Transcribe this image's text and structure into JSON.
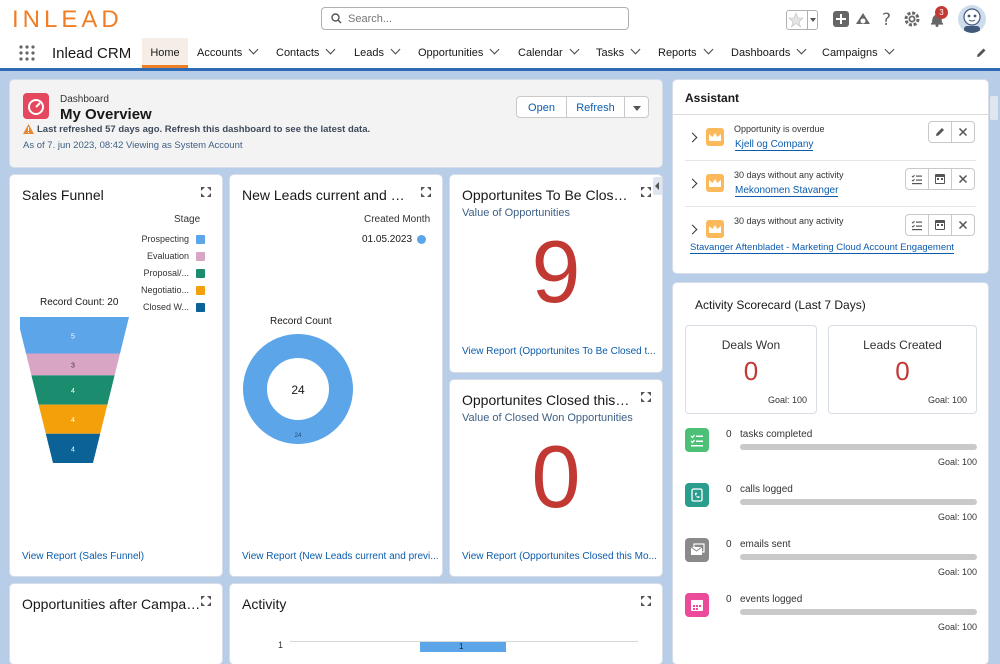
{
  "header": {
    "logo": "INLEAD",
    "search_placeholder": "Search...",
    "notification_count": "3"
  },
  "nav": {
    "app_name": "Inlead CRM",
    "items": [
      "Home",
      "Accounts",
      "Contacts",
      "Leads",
      "Opportunities",
      "Calendar",
      "Tasks",
      "Reports",
      "Dashboards",
      "Campaigns"
    ]
  },
  "dashboard": {
    "label": "Dashboard",
    "title": "My Overview",
    "warning": "Last refreshed 57 days ago. Refresh this dashboard to see the latest data.",
    "as_of": "As of 7. jun 2023, 08:42 Viewing as System Account",
    "open_label": "Open",
    "refresh_label": "Refresh"
  },
  "sales_funnel": {
    "title": "Sales Funnel",
    "legend_title": "Stage",
    "record_count_label": "Record Count: 20",
    "view_report": "View Report (Sales Funnel)"
  },
  "new_leads": {
    "title": "New Leads current and previ...",
    "legend_title": "Created Month",
    "record_count_label": "Record Count",
    "view_report": "View Report (New Leads current and previ..."
  },
  "opps_to_close": {
    "title": "Opportunites To Be Closed t...",
    "subtitle": "Value of Opportunities",
    "value": "9",
    "view_report": "View Report (Opportunites To Be Closed t..."
  },
  "opps_closed": {
    "title": "Opportunites Closed this Mo...",
    "subtitle": "Value of Closed Won Opportunities",
    "value": "0",
    "view_report": "View Report (Opportunites Closed this Mo..."
  },
  "opps_campaigns": {
    "title": "Opportunities after Campaigns"
  },
  "activity": {
    "title": "Activity",
    "axis_tick": "1",
    "bar_label": "1"
  },
  "assistant": {
    "title": "Assistant",
    "items": [
      {
        "text": "Opportunity is overdue",
        "link": "Kjell og Company"
      },
      {
        "text": "30 days without any activity",
        "link": "Mekonomen Stavanger"
      },
      {
        "text": "30 days without any activity",
        "link": "Stavanger Aftenbladet - Marketing Cloud Account Engagement"
      }
    ]
  },
  "scorecard": {
    "title": "Activity Scorecard (Last 7 Days)",
    "kpis": [
      {
        "label": "Deals Won",
        "value": "0",
        "goal": "Goal: 100"
      },
      {
        "label": "Leads Created",
        "value": "0",
        "goal": "Goal: 100"
      }
    ],
    "activities": [
      {
        "count": "0",
        "label": "tasks completed",
        "goal": "Goal: 100",
        "color": "#4bc076"
      },
      {
        "count": "0",
        "label": "calls logged",
        "goal": "Goal: 100",
        "color": "#2a9d8f"
      },
      {
        "count": "0",
        "label": "emails sent",
        "goal": "Goal: 100",
        "color": "#8a8a8a"
      },
      {
        "count": "0",
        "label": "events logged",
        "goal": "Goal: 100",
        "color": "#eb4b9a"
      }
    ]
  },
  "chart_data": [
    {
      "type": "funnel",
      "legend_title": "Stage",
      "categories": [
        "Prospecting",
        "Evaluation",
        "Proposal/...",
        "Negotiatio...",
        "Closed W..."
      ],
      "values": [
        5,
        3,
        4,
        4,
        4
      ],
      "colors": [
        "#5ba5e8",
        "#d9a5c5",
        "#1b8c6d",
        "#f4a00b",
        "#0b6296"
      ],
      "record_count": 20
    },
    {
      "type": "pie",
      "legend_title": "Created Month",
      "categories": [
        "01.05.2023"
      ],
      "values": [
        24
      ],
      "center_label": "24",
      "colors": [
        "#5ba5e8"
      ]
    },
    {
      "type": "bar",
      "ytick": "1",
      "values": [
        1
      ],
      "colors": [
        "#5ba5e8"
      ]
    }
  ]
}
